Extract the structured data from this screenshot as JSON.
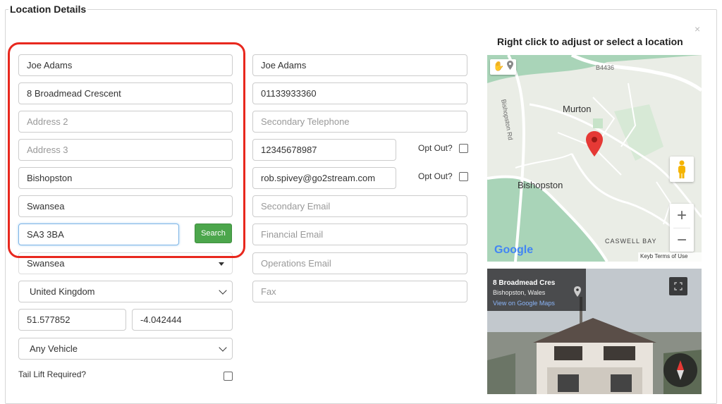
{
  "section_title": "Location Details",
  "close_symbol": "×",
  "left_column": {
    "name": "Joe Adams",
    "address1": "8 Broadmead Crescent",
    "address2_placeholder": "Address 2",
    "address3_placeholder": "Address 3",
    "town": "Bishopston",
    "city": "Swansea",
    "postcode": "SA3 3BA",
    "search_label": "Search",
    "county_selected": "Swansea",
    "country_selected": "United Kingdom",
    "latitude": "51.577852",
    "longitude": "-4.042444",
    "vehicle_selected": "Any Vehicle",
    "tail_lift_label": "Tail Lift Required?"
  },
  "right_column": {
    "contact_name": "Joe Adams",
    "telephone": "01133933360",
    "secondary_telephone_placeholder": "Secondary Telephone",
    "mobile": "12345678987",
    "opt_out_label_1": "Opt Out?",
    "email": "rob.spivey@go2stream.com",
    "opt_out_label_2": "Opt Out?",
    "secondary_email_placeholder": "Secondary Email",
    "financial_email_placeholder": "Financial Email",
    "operations_email_placeholder": "Operations Email",
    "fax_placeholder": "Fax"
  },
  "map": {
    "title": "Right click to adjust or select a location",
    "labels": {
      "b4436": "B4436",
      "murton": "Murton",
      "bishopston_rd": "Bishopston Rd",
      "bishopston": "Bishopston",
      "caswell_bay": "CASWELL BAY"
    },
    "google_logo": "Google",
    "footer_text": "Keyb  Terms of Use",
    "zoom_in": "+",
    "zoom_out": "−",
    "colors": {
      "land": "#e9ece5",
      "green": "#a9d4b8",
      "pin": "#e53935",
      "pegman": "#f5b400"
    },
    "icons": [
      "hand-icon",
      "pin-icon",
      "pegman-icon",
      "zoom-in-icon",
      "zoom-out-icon"
    ]
  },
  "street_view": {
    "title": "8 Broadmead Cres",
    "subtitle": "Bishopston, Wales",
    "link": "View on Google Maps",
    "icons": [
      "location-pin-icon",
      "fullscreen-icon",
      "compass-icon"
    ]
  }
}
